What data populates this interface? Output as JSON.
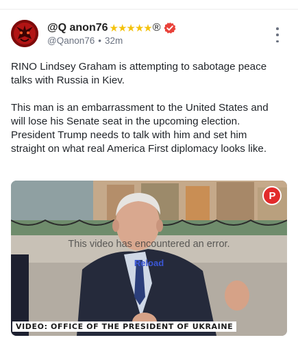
{
  "post": {
    "author": {
      "display_name": "@Q anon76",
      "stars": "★★★★★",
      "registered_mark": "®",
      "handle": "@Qanon76",
      "separator": "•",
      "timestamp": "32m",
      "verified_color": "#e9423a",
      "star_color": "#f4c20d"
    },
    "paragraphs": [
      "RINO Lindsey Graham is attempting to sabotage peace talks with Russia in Kiev.",
      "This man is an embarrassment to the United States and will lose his Senate seat in the upcoming election. President Trump needs to talk with him and set him straight on what real America First diplomacy looks like."
    ],
    "video": {
      "error_message": "This video has encountered an error.",
      "reload_label": "Reload",
      "caption": "VIDEO: OFFICE OF THE PRESIDENT OF UKRAINE",
      "logo_letter": "P",
      "logo_color": "#e22b2b"
    },
    "menu_icon": "more-vertical-icon"
  }
}
